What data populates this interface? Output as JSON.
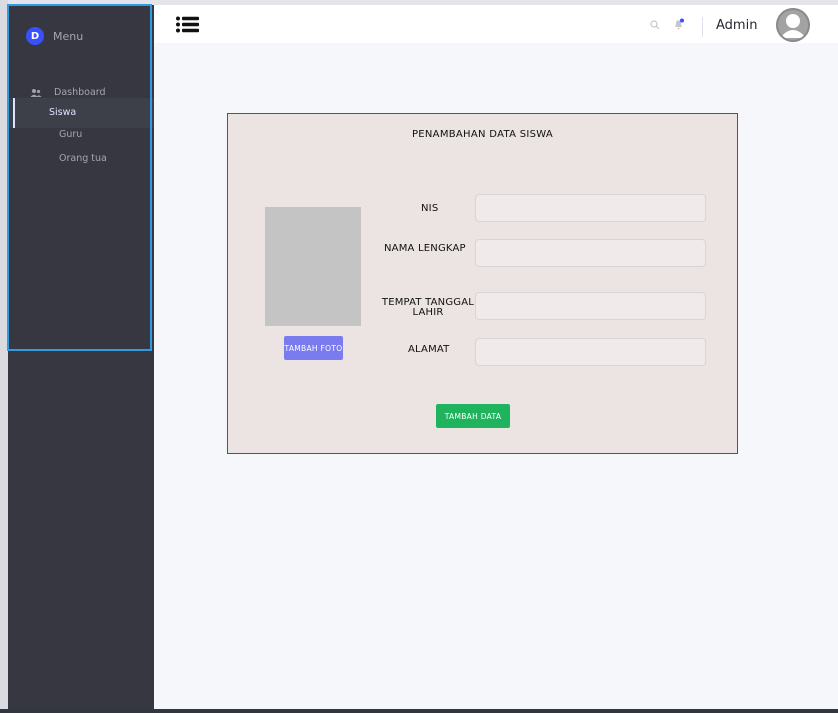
{
  "sidebar": {
    "brand_initial": "D",
    "brand_label": "Menu",
    "items": [
      {
        "label": "Dashboard",
        "icon": "users-icon"
      },
      {
        "label": "Siswa",
        "active": true
      },
      {
        "label": "Guru"
      },
      {
        "label": "Orang tua"
      }
    ]
  },
  "topbar": {
    "menu_icon": "list-icon",
    "search_icon": "search-icon",
    "bell_icon": "bell-icon",
    "user_name": "Admin",
    "avatar_icon": "user-avatar-icon"
  },
  "form": {
    "title": "PENAMBAHAN DATA SISWA",
    "photo_button": "TAMBAH FOTO",
    "fields": [
      {
        "label": "NIS",
        "value": ""
      },
      {
        "label": "NAMA LENGKAP",
        "value": ""
      },
      {
        "label": "TEMPAT TANGGAL LAHIR",
        "value": ""
      },
      {
        "label": "ALAMAT",
        "value": ""
      }
    ],
    "submit_button": "TAMBAH DATA"
  },
  "colors": {
    "sidebar_bg": "#363740",
    "accent": "#3751ff",
    "photo_button": "#7b7bf0",
    "submit_button": "#1fb35e",
    "card_bg": "#ece3e3"
  }
}
